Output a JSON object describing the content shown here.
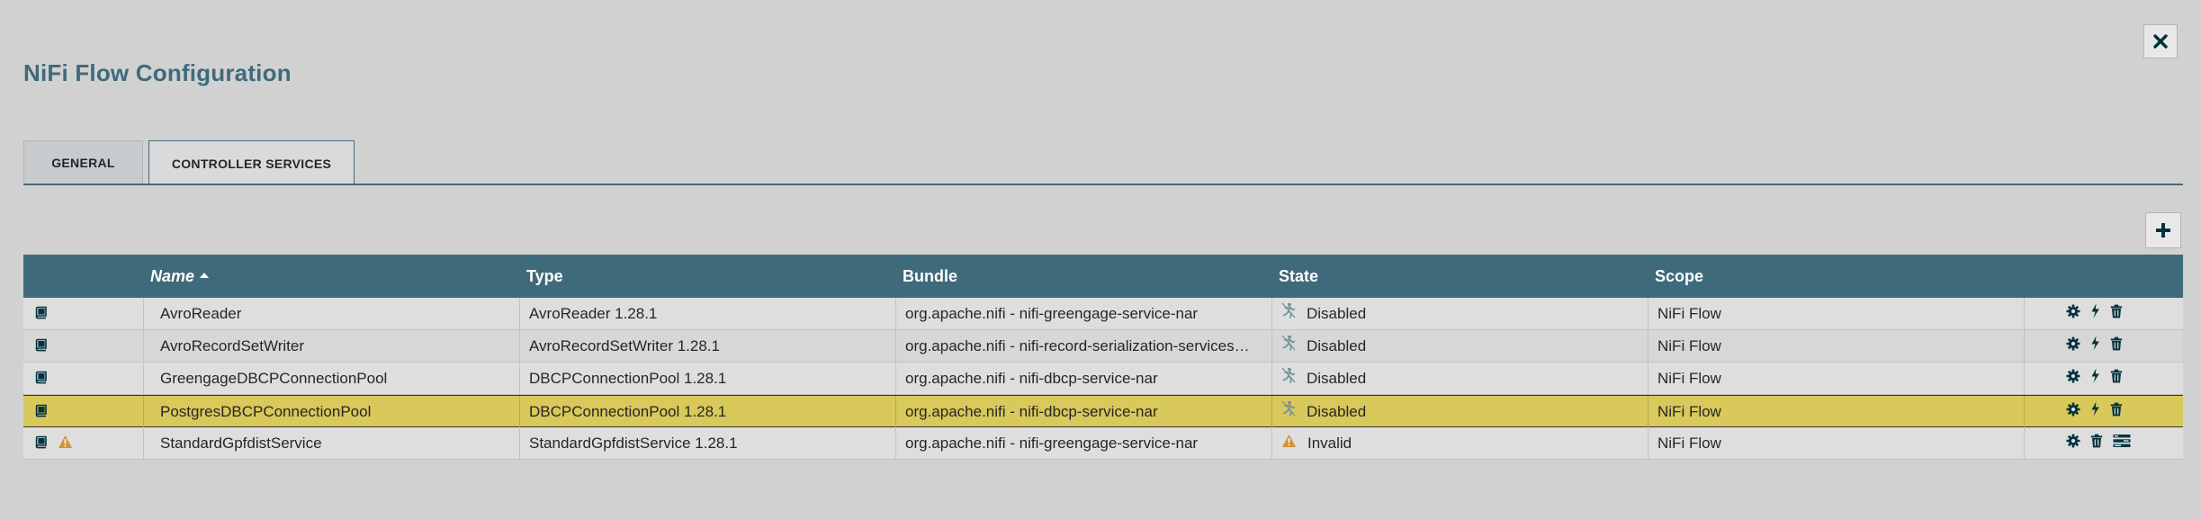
{
  "dialog": {
    "title": "NiFi Flow Configuration"
  },
  "tabs": [
    {
      "label": "GENERAL"
    },
    {
      "label": "CONTROLLER SERVICES"
    }
  ],
  "table": {
    "columns": {
      "name": "Name",
      "type": "Type",
      "bundle": "Bundle",
      "state": "State",
      "scope": "Scope"
    },
    "sort": {
      "column": "Name",
      "direction": "ascending"
    },
    "rows": [
      {
        "name": "AvroReader",
        "type": "AvroReader 1.28.1",
        "bundle": "org.apache.nifi - nifi-greengage-service-nar",
        "state": "Disabled",
        "state_icon": "disabled-icon",
        "scope": "NiFi Flow",
        "warning": false,
        "selected": false,
        "actions": [
          "configure-icon",
          "enable-icon",
          "delete-icon"
        ]
      },
      {
        "name": "AvroRecordSetWriter",
        "type": "AvroRecordSetWriter 1.28.1",
        "bundle": "org.apache.nifi - nifi-record-serialization-services…",
        "state": "Disabled",
        "state_icon": "disabled-icon",
        "scope": "NiFi Flow",
        "warning": false,
        "selected": false,
        "actions": [
          "configure-icon",
          "enable-icon",
          "delete-icon"
        ]
      },
      {
        "name": "GreengageDBCPConnectionPool",
        "type": "DBCPConnectionPool 1.28.1",
        "bundle": "org.apache.nifi - nifi-dbcp-service-nar",
        "state": "Disabled",
        "state_icon": "disabled-icon",
        "scope": "NiFi Flow",
        "warning": false,
        "selected": false,
        "actions": [
          "configure-icon",
          "enable-icon",
          "delete-icon"
        ]
      },
      {
        "name": "PostgresDBCPConnectionPool",
        "type": "DBCPConnectionPool 1.28.1",
        "bundle": "org.apache.nifi - nifi-dbcp-service-nar",
        "state": "Disabled",
        "state_icon": "disabled-icon",
        "scope": "NiFi Flow",
        "warning": false,
        "selected": true,
        "actions": [
          "configure-icon",
          "enable-icon",
          "delete-icon"
        ]
      },
      {
        "name": "StandardGpfdistService",
        "type": "StandardGpfdistService 1.28.1",
        "bundle": "org.apache.nifi - nifi-greengage-service-nar",
        "state": "Invalid",
        "state_icon": "warning-icon",
        "scope": "NiFi Flow",
        "warning": true,
        "selected": false,
        "actions": [
          "configure-icon",
          "delete-icon",
          "access-policies-icon"
        ]
      }
    ]
  },
  "colors": {
    "accent": "#3f6a7b",
    "selected_row": "#d9c85a",
    "warning": "#cf9338",
    "icon": "#00333f"
  }
}
